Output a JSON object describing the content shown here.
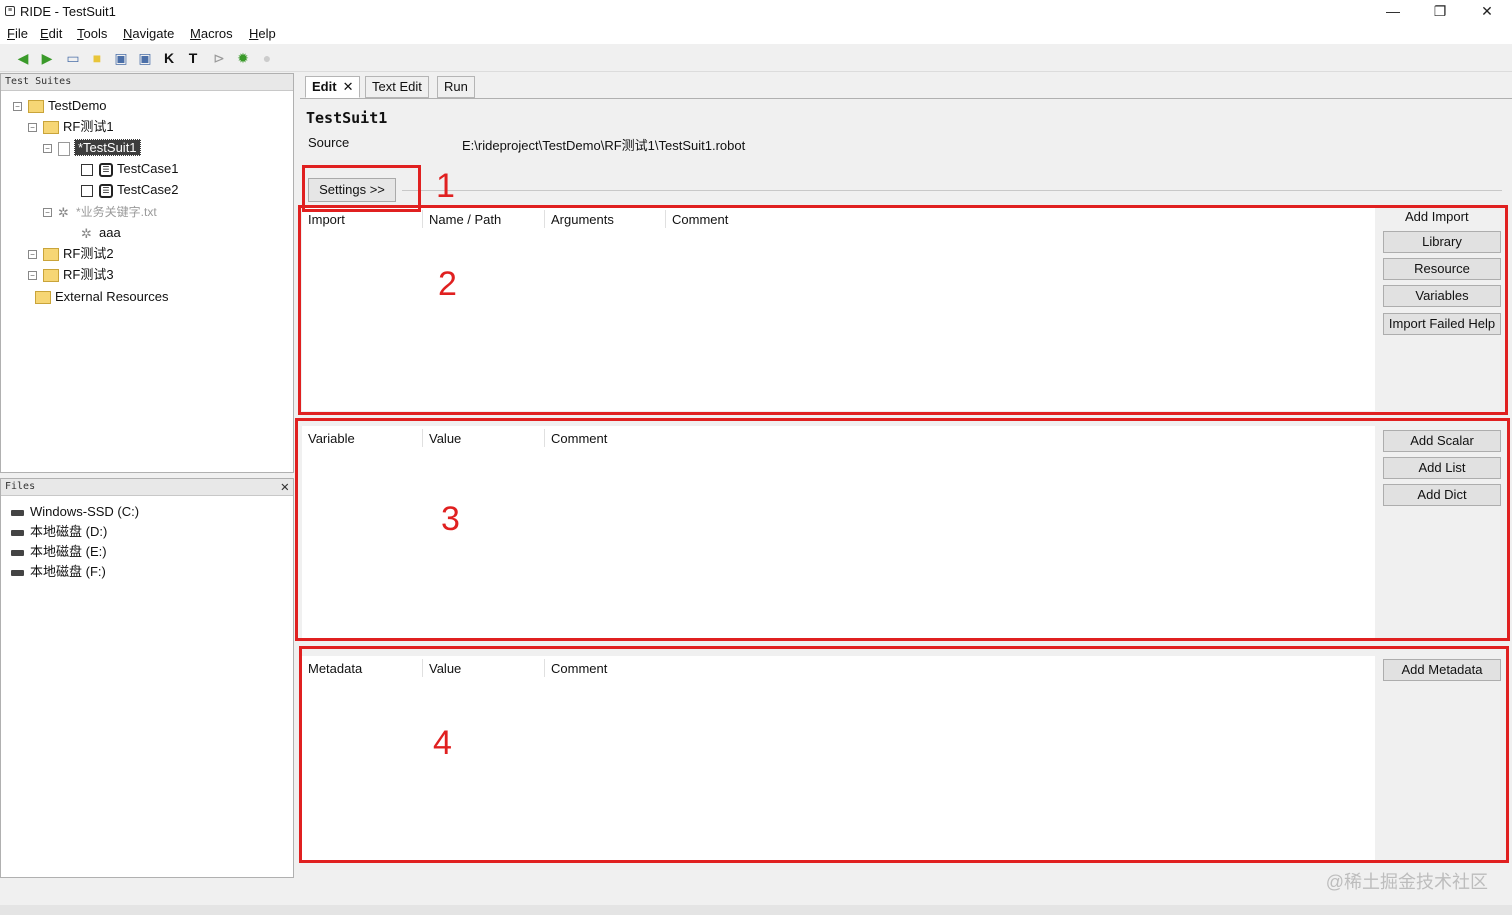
{
  "window": {
    "title": "RIDE - TestSuit1",
    "app_icon": "ride-app-icon",
    "controls": [
      "—",
      "❐",
      "✕"
    ]
  },
  "menu": [
    {
      "key": "F",
      "rest": "ile"
    },
    {
      "key": "E",
      "rest": "dit"
    },
    {
      "key": "T",
      "rest": "ools"
    },
    {
      "key": "N",
      "rest": "avigate"
    },
    {
      "key": "M",
      "rest": "acros"
    },
    {
      "key": "H",
      "rest": "elp"
    }
  ],
  "toolbar": [
    "back-arrow-icon",
    "forward-arrow-icon",
    "open-folder-icon",
    "new-folder-icon",
    "save-icon",
    "save-all-icon",
    "keyword-search-icon",
    "test-search-icon",
    "run-icon",
    "settings-gear-icon",
    "stop-icon"
  ],
  "suites_pane": {
    "header": "Test Suites",
    "items": [
      {
        "label": "TestDemo"
      },
      {
        "label": "RF测试1"
      },
      {
        "label": "*TestSuit1"
      },
      {
        "label": "TestCase1"
      },
      {
        "label": "TestCase2"
      },
      {
        "label": "*业务关键字.txt"
      },
      {
        "label": "aaa"
      },
      {
        "label": "RF测试2"
      },
      {
        "label": "RF测试3"
      },
      {
        "label": "External Resources"
      }
    ]
  },
  "files_pane": {
    "header": "Files",
    "close": "✕",
    "drives": [
      "Windows-SSD (C:)",
      "本地磁盘 (D:)",
      "本地磁盘 (E:)",
      "本地磁盘 (F:)"
    ]
  },
  "tabs": [
    {
      "label": "Edit",
      "close": "✕"
    },
    {
      "label": "Text Edit"
    },
    {
      "label": "Run"
    }
  ],
  "editor": {
    "suite_name": "TestSuit1",
    "source_label": "Source",
    "source_path": "E:\\rideproject\\TestDemo\\RF测试1\\TestSuit1.robot",
    "settings_button": "Settings >>",
    "imports": {
      "columns": [
        "Import",
        "Name / Path",
        "Arguments",
        "Comment"
      ],
      "buttons": [
        "Add Import",
        "Library",
        "Resource",
        "Variables",
        "Import Failed Help"
      ]
    },
    "variables": {
      "columns": [
        "Variable",
        "Value",
        "Comment"
      ],
      "buttons": [
        "Add Scalar",
        "Add List",
        "Add Dict"
      ]
    },
    "metadata": {
      "columns": [
        "Metadata",
        "Value",
        "Comment"
      ],
      "buttons": [
        "Add Metadata"
      ]
    }
  },
  "annotations": [
    "1",
    "2",
    "3",
    "4"
  ],
  "annotation_color": "#e02020",
  "watermark": "@稀土掘金技术社区"
}
